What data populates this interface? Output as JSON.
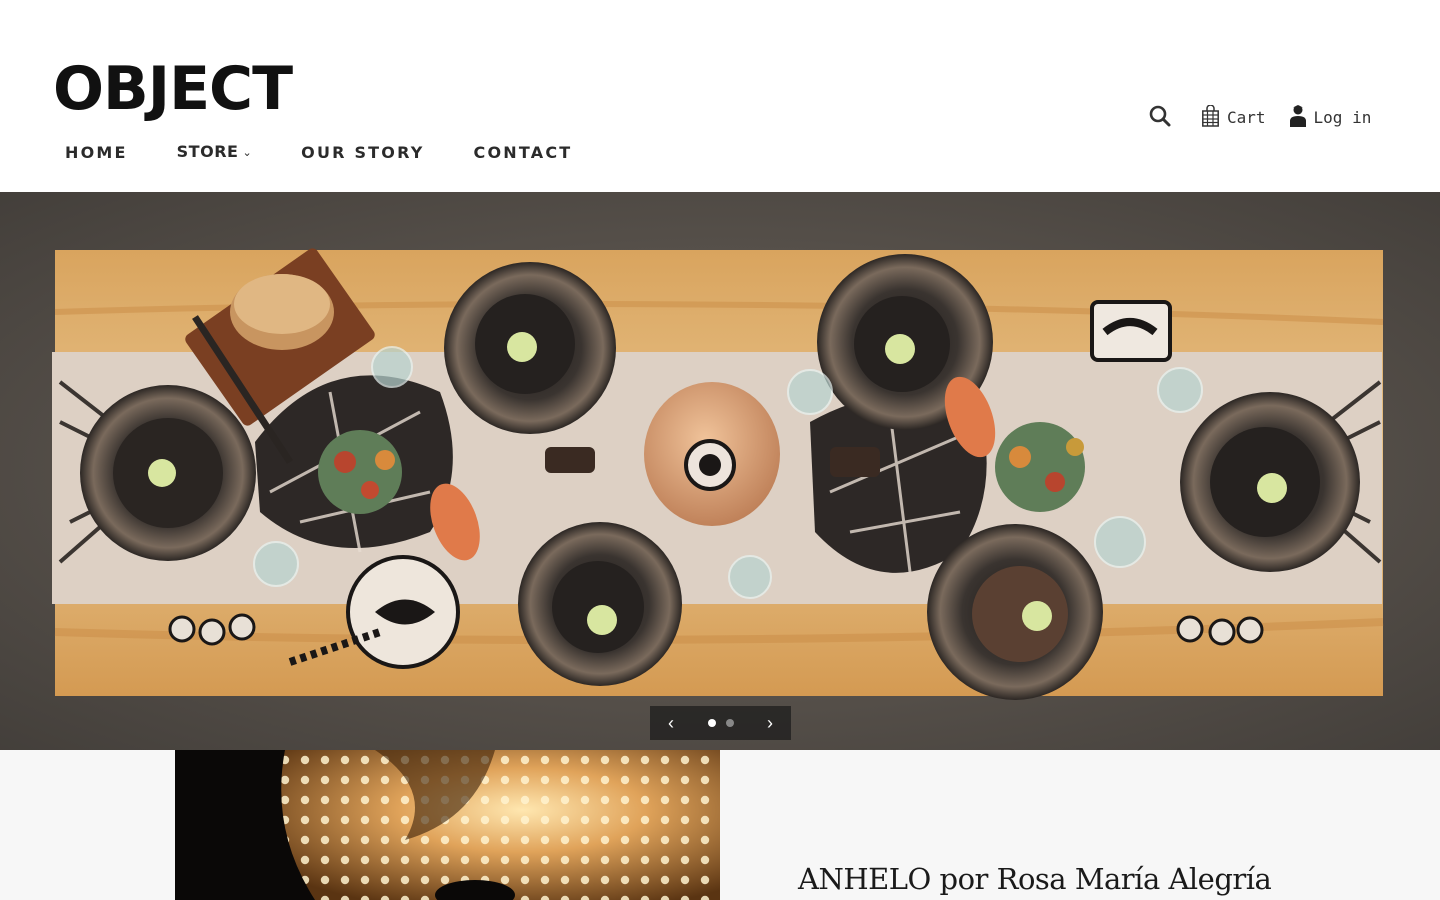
{
  "brand": {
    "name": "OBJECT"
  },
  "nav": {
    "items": [
      {
        "label": "HOME"
      },
      {
        "label": "STORE",
        "has_dropdown": true
      },
      {
        "label": "OUR STORY"
      },
      {
        "label": "CONTACT"
      }
    ]
  },
  "header_tools": {
    "search_icon": "search-icon",
    "cart_label": "Cart",
    "cart_icon": "shopping-bag-icon",
    "login_label": "Log in",
    "login_icon": "user-icon"
  },
  "hero": {
    "image_subject": "table setting with black ceramics, linen runner and flowers",
    "slides_total": 2,
    "active_slide": 1,
    "prev_icon": "chevron-left-icon",
    "next_icon": "chevron-right-icon"
  },
  "feature": {
    "title": "ANHELO por Rosa María Alegría",
    "image_subject": "perforated ceramic lamp glowing warm"
  },
  "colors": {
    "text": "#1a1a1a",
    "background": "#ffffff",
    "lower_background": "#f7f7f7",
    "slider_control_bg": "#191919"
  }
}
